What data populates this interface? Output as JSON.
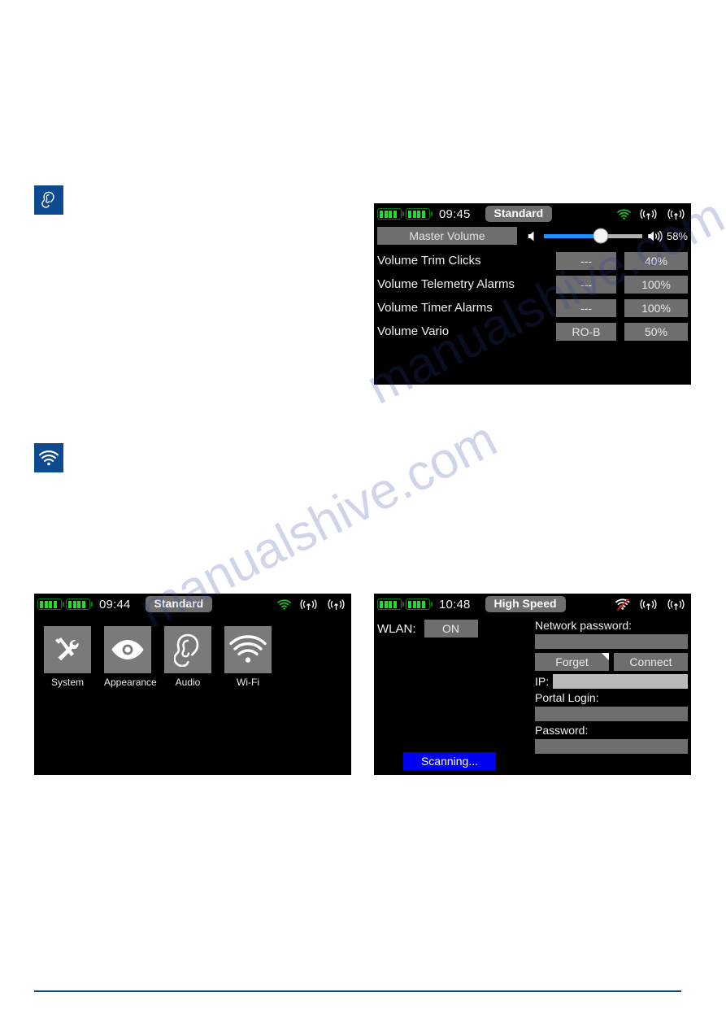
{
  "page": {
    "watermark": [
      "manualshive.com",
      "manualshive.com"
    ],
    "footer_rule_color": "#0d4f6e"
  },
  "section_icons": [
    {
      "name": "audio-section-icon",
      "glyph": "ear-icon",
      "bg": "#0d4a8f"
    },
    {
      "name": "wifi-section-icon",
      "glyph": "wifi-icon",
      "bg": "#0d4a8f"
    }
  ],
  "audio_screen": {
    "statusbar": {
      "battery_bars": 4,
      "battery_count": 2,
      "clock": "09:45",
      "mode": "Standard",
      "wifi_icon": "wifi-connected-icon",
      "wifi_color": "#22c022",
      "rf_icons": [
        "antenna-icon",
        "antenna-icon"
      ]
    },
    "master": {
      "label": "Master Volume",
      "volume_percent": "58%",
      "volume_value": 58,
      "speaker_mute_icon": "speaker-low-icon",
      "speaker_loud_icon": "speaker-high-icon",
      "fill_color": "#1e90ff",
      "track_color": "#b0b0b0"
    },
    "rows": [
      {
        "label": "Volume Trim Clicks",
        "source": "---",
        "value": "40%"
      },
      {
        "label": "Volume Telemetry Alarms",
        "source": "---",
        "value": "100%"
      },
      {
        "label": "Volume Timer Alarms",
        "source": "---",
        "value": "100%"
      },
      {
        "label": "Volume Vario",
        "source": "RO-B",
        "value": "50%"
      }
    ]
  },
  "menu_screen": {
    "statusbar": {
      "battery_bars": 4,
      "battery_count": 2,
      "clock": "09:44",
      "mode": "Standard",
      "wifi_icon": "wifi-connected-icon",
      "wifi_color": "#22c022",
      "rf_icons": [
        "antenna-icon",
        "antenna-icon"
      ]
    },
    "items": [
      {
        "label": "System",
        "icon": "tools-icon"
      },
      {
        "label": "Appearance",
        "icon": "eye-icon"
      },
      {
        "label": "Audio",
        "icon": "ear-icon"
      },
      {
        "label": "Wi-Fi",
        "icon": "wifi-icon"
      }
    ]
  },
  "wifi_screen": {
    "statusbar": {
      "battery_bars": 4,
      "battery_count": 2,
      "clock": "10:48",
      "mode": "High Speed",
      "wifi_icon": "wifi-disconnected-icon",
      "wifi_color": "#ffffff",
      "wifi_slash_color": "#d02020",
      "rf_icons": [
        "antenna-icon",
        "antenna-icon"
      ]
    },
    "wlan": {
      "label": "WLAN:",
      "state": "ON"
    },
    "scanning_label": "Scanning...",
    "scanning_color": "#0000f0",
    "fields": {
      "network_password_label": "Network password:",
      "network_password_value": "",
      "forget_label": "Forget",
      "connect_label": "Connect",
      "ip_label": "IP:",
      "ip_value": "",
      "portal_login_label": "Portal Login:",
      "portal_login_value": "",
      "password_label": "Password:",
      "password_value": ""
    }
  }
}
